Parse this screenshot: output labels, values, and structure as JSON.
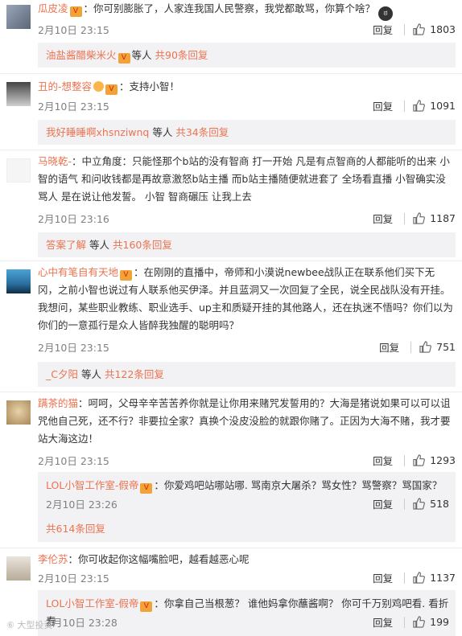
{
  "comments": [
    {
      "user": "瓜皮凌",
      "text": "：你可别膨胀了，人家连我国人民警察，我党都敢骂，你算个啥？",
      "time": "2月10日 23:15",
      "reply": "回复",
      "likes": "1803",
      "replies_user": "油盐酱醋柴米火",
      "replies_mid": "等人",
      "replies_count": "共90条回复"
    },
    {
      "user": "丑的-想整容",
      "text": "：支持小智！",
      "time": "2月10日 23:15",
      "reply": "回复",
      "likes": "1091",
      "replies_user": "我好睡睡啊xhsnziwnq",
      "replies_mid": "等人",
      "replies_count": "共34条回复"
    },
    {
      "user": "马晓乾-",
      "text": "：中立角度：只能怪那个b站的没有智商 打一开始 凡是有点智商的人都能听的出来 小智的语气 和问收钱都是再故意激怒b站主播 而b站主播随便就进套了 全场看直播 小智确实没骂人 是在说让他发誓。 小智 智商碾压 让我上去",
      "time": "2月10日 23:16",
      "reply": "回复",
      "likes": "1187",
      "replies_user": "答案了解",
      "replies_mid": "等人",
      "replies_count": "共160条回复"
    },
    {
      "user": "心中有笔自有天地",
      "text": "：在刚刚的直播中，帝师和小漠说newbee战队正在联系他们买下无冈，之前小智也说过有人联系他买伊泽。并且蓝洞又一次回复了全民，说全民战队没有开挂。我想问，某些职业教练、职业选手、up主和质疑开挂的其他路人，还在执迷不悟吗？你们以为你们的一意孤行是众人皆醉我独醒的聪明吗？",
      "time": "2月10日 23:15",
      "reply": "回复",
      "likes": "751",
      "replies_user": "_C夕阳",
      "replies_mid": "等人",
      "replies_count": "共122条回复"
    },
    {
      "user": "蹒茶的猫",
      "text": "：呵呵，父母辛辛苦苦养你就是让你用来赌咒发誓用的？大海是猪说如果可以可以诅咒他自己死，还不行？非要拉全家？真换个没皮没脸的就跟你赌了。正因为大海不赌，我才要站大海这边！",
      "time": "2月10日 23:15",
      "reply": "回复",
      "likes": "1293",
      "sub_user": "LOL小智工作室-假帝",
      "sub_text": "：你爱鸡吧站哪站哪. 骂南京大屠杀？骂女性？骂警察？骂国家？",
      "sub_time": "2月10日 23:26",
      "sub_reply": "回复",
      "sub_likes": "518",
      "sub_count": "共614条回复"
    },
    {
      "user": "李伦苏",
      "text": "：你可收起你这幅嘴脸吧，越看越恶心呢",
      "time": "2月10日 23:15",
      "reply": "回复",
      "likes": "1137",
      "sub_user": "LOL小智工作室-假帝",
      "sub_text": "：你拿自己当根葱？ 谁他妈拿你蘸酱啊？ 你可千万别鸡吧看. 看折寿",
      "sub_time": "2月10日 23:28",
      "sub_reply": "回复",
      "sub_likes": "199"
    }
  ],
  "vip_badge": "V",
  "emoji_glyph": "ಠ",
  "watermark": "⑥ 大型投资"
}
